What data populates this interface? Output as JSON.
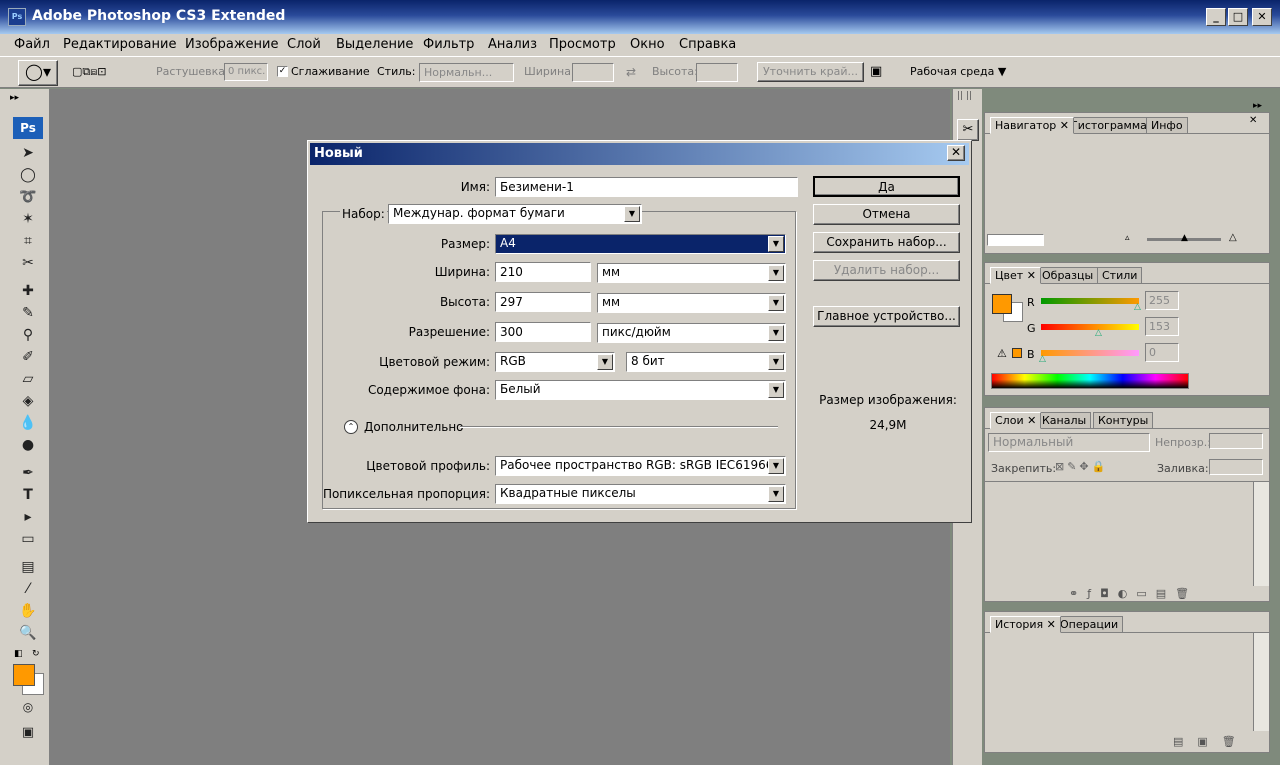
{
  "window": {
    "title": "Adobe Photoshop CS3 Extended",
    "min": "_",
    "max": "□",
    "close": "✕"
  },
  "menu": [
    "Файл",
    "Редактирование",
    "Изображение",
    "Слой",
    "Выделение",
    "Фильтр",
    "Анализ",
    "Просмотр",
    "Окно",
    "Справка"
  ],
  "options": {
    "feather_label": "Растушевка:",
    "feather_value": "0 пикс.",
    "antialias_label": "Сглаживание",
    "style_label": "Стиль:",
    "style_value": "Нормальн...",
    "width_label": "Ширина:",
    "height_label": "Высота:",
    "refine_button": "Уточнить край...",
    "workspace_label": "Рабочая среда ▼"
  },
  "toolbox": {
    "ps_logo": "Ps"
  },
  "dialog": {
    "title": "Новый",
    "close": "✕",
    "name_label": "Имя:",
    "name_value": "Безимени-1",
    "preset_label": "Набор:",
    "preset_value": "Междунар. формат бумаги",
    "size_label": "Размер:",
    "size_value": "A4",
    "width_label": "Ширина:",
    "width_value": "210",
    "width_unit": "мм",
    "height_label": "Высота:",
    "height_value": "297",
    "height_unit": "мм",
    "resolution_label": "Разрешение:",
    "resolution_value": "300",
    "resolution_unit": "пикс/дюйм",
    "colormode_label": "Цветовой режим:",
    "colormode_value": "RGB",
    "bitdepth_value": "8 бит",
    "background_label": "Содержимое фона:",
    "background_value": "Белый",
    "advanced_label": "Дополнительно",
    "profile_label": "Цветовой профиль:",
    "profile_value": "Рабочее пространство RGB:  sRGB IEC61966...",
    "pixel_aspect_label": "Попиксельная пропорция:",
    "pixel_aspect_value": "Квадратные пикселы",
    "ok": "Да",
    "cancel": "Отмена",
    "save_preset": "Сохранить набор...",
    "delete_preset": "Удалить набор...",
    "device_central": "Главное устройство...",
    "image_size_label": "Размер изображения:",
    "image_size_value": "24,9M"
  },
  "navigator_panel": {
    "tabs": [
      "Навигатор",
      "Гистограмма",
      "Инфо"
    ]
  },
  "color_panel": {
    "tabs": [
      "Цвет",
      "Образцы",
      "Стили"
    ],
    "r_label": "R",
    "g_label": "G",
    "b_label": "B",
    "r": "255",
    "g": "153",
    "b": "0",
    "fg_color": "#ff9900"
  },
  "layers_panel": {
    "tabs": [
      "Слои",
      "Каналы",
      "Контуры"
    ],
    "blend_mode": "Нормальный",
    "opacity_label": "Непрозр.:",
    "lock_label": "Закрепить:",
    "fill_label": "Заливка:"
  },
  "history_panel": {
    "tabs": [
      "История",
      "Операции"
    ]
  }
}
